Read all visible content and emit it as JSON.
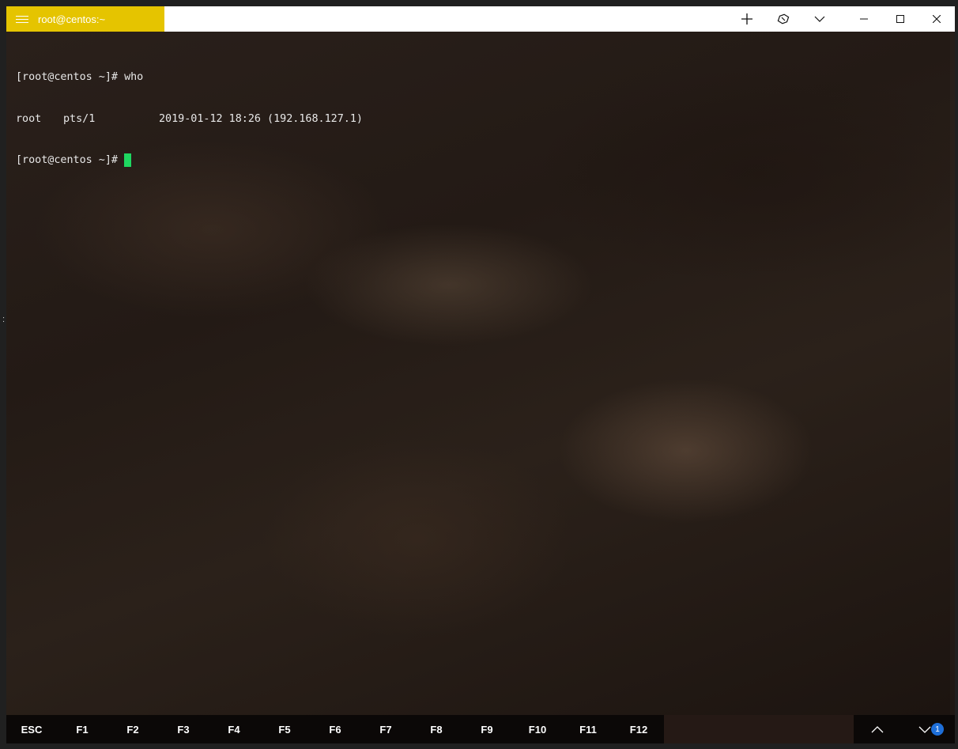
{
  "window": {
    "tab_title": "root@centos:~",
    "accent_color": "#e5c400"
  },
  "titlebar_buttons": {
    "new_tab": "plus-icon",
    "tab_style": "eraser-icon",
    "dropdown": "chevron-down-icon",
    "minimize": "minimize-icon",
    "maximize": "maximize-icon",
    "close": "close-icon"
  },
  "terminal": {
    "line1_prompt": "[root@centos ~]#",
    "line1_command": "who",
    "who_user": "root",
    "who_tty": "pts/1",
    "who_time": "2019-01-12 18:26 (192.168.127.1)",
    "line3_prompt": "[root@centos ~]#",
    "cursor_color": "#1ed760"
  },
  "keybar": {
    "keys": [
      "ESC",
      "F1",
      "F2",
      "F3",
      "F4",
      "F5",
      "F6",
      "F7",
      "F8",
      "F9",
      "F10",
      "F11",
      "F12"
    ],
    "notification_count": "1"
  }
}
